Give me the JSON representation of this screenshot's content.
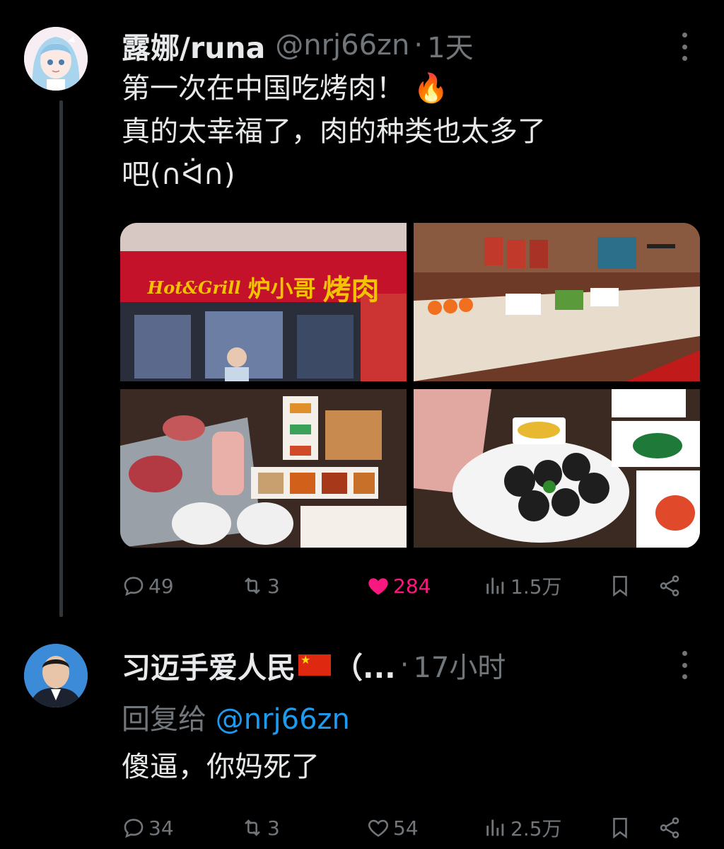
{
  "tweet": {
    "name": "露娜/runa",
    "handle": "@nrj66zn",
    "separator": "·",
    "time": "1天",
    "line1": "第一次在中国吃烤肉！ 🔥",
    "line2": "真的太幸福了，肉的种类也太多了",
    "line3": "吧(∩ᐛ∩)",
    "media_sign": {
      "brand_en": "Hot&Grill",
      "brand_cn": "炉小哥",
      "brand_cn2": "烤肉"
    },
    "stats": {
      "replies": "49",
      "retweets": "3",
      "likes": "284",
      "views": "1.5万"
    }
  },
  "reply": {
    "name": "习迈手爱人民",
    "name_suffix": "（...",
    "separator": "·",
    "time": "17小时",
    "reply_label": "回复给",
    "reply_mention": "@nrj66zn",
    "text": "傻逼，你妈死了",
    "stats": {
      "replies": "34",
      "retweets": "3",
      "likes": "54",
      "views": "2.5万"
    }
  },
  "colors": {
    "background": "#000000",
    "text": "#e7e9ea",
    "muted": "#71767b",
    "link": "#1d9bf0",
    "like": "#f91880"
  }
}
